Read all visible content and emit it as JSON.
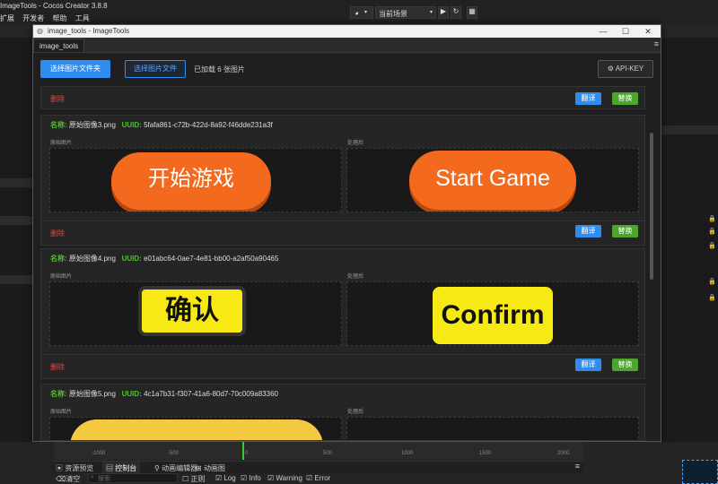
{
  "app": {
    "title": "ImageTools - Cocos Creator 3.8.8",
    "menu": [
      "扩展",
      "开发者",
      "帮助",
      "工具"
    ],
    "scene_select": "当前场景"
  },
  "dialog": {
    "title": "image_tools - ImageTools",
    "tab": "image_tools",
    "toolbar": {
      "select_folder": "选择图片文件夹",
      "select_file": "选择图片文件",
      "loaded_status": "已加载 6 张图片",
      "api_key": "API-KEY"
    },
    "actions": {
      "delete": "删除",
      "translate": "翻译",
      "replace": "替换"
    },
    "labels": {
      "name": "名称:",
      "uuid": "UUID:",
      "original": "原始图片",
      "processed": "处理后"
    },
    "items": [
      {
        "name": "原始图像3.png",
        "uuid": "5fafa861-c72b-422d-8a92-f46dde231a3f",
        "original_text": "开始游戏",
        "processed_text": "Start Game"
      },
      {
        "name": "原始图像4.png",
        "uuid": "e01abc64-0ae7-4e81-bb00-a2af50a90465",
        "original_text": "确认",
        "processed_text": "Confirm"
      },
      {
        "name": "原始图像5.png",
        "uuid": "4c1a7b31-f307-41a6-80d7-70c009a83360"
      }
    ]
  },
  "timeline": {
    "ticks": [
      "-1000",
      "-500",
      "0",
      "500",
      "1000",
      "1500",
      "2000"
    ]
  },
  "bottom": {
    "tabs": [
      "资源预览",
      "控制台",
      "动画编辑器",
      "动画图"
    ],
    "console": {
      "clear": "清空",
      "search_placeholder": "搜索",
      "filters": [
        "正则",
        "Log",
        "Info",
        "Warning",
        "Error"
      ]
    }
  },
  "colors": {
    "accent_blue": "#2f8cf0",
    "accent_green": "#4ea52e",
    "danger": "#e04848",
    "button_orange": "#f36a1e",
    "button_yellow": "#f7ea14"
  }
}
